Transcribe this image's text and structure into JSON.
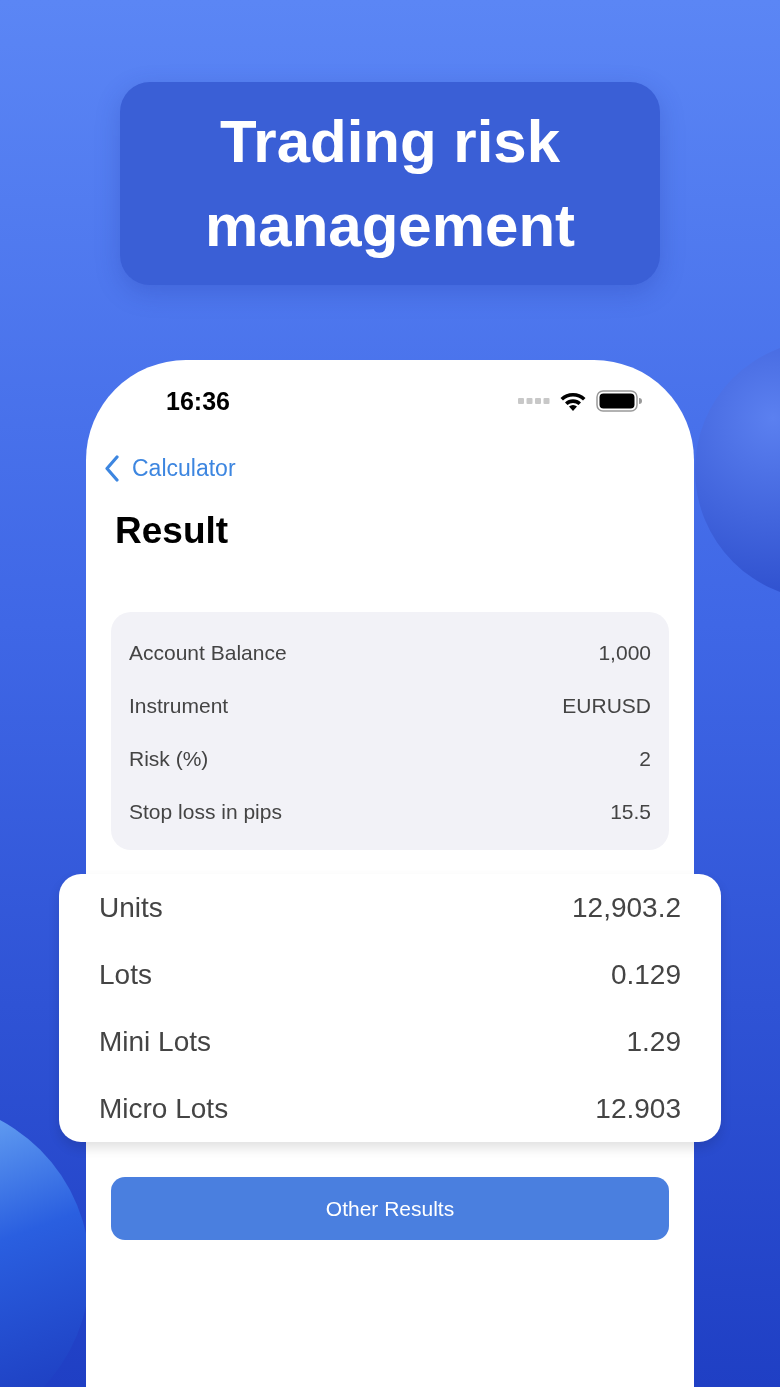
{
  "headline": "Trading risk management",
  "status_bar": {
    "time": "16:36"
  },
  "nav": {
    "back_label": "Calculator",
    "title": "Result"
  },
  "inputs": [
    {
      "label": "Account Balance",
      "value": "1,000"
    },
    {
      "label": "Instrument",
      "value": "EURUSD"
    },
    {
      "label": "Risk (%)",
      "value": "2"
    },
    {
      "label": "Stop loss in pips",
      "value": "15.5"
    }
  ],
  "results": [
    {
      "label": "Units",
      "value": "12,903.2"
    },
    {
      "label": "Lots",
      "value": "0.129"
    },
    {
      "label": "Mini Lots",
      "value": "1.29"
    },
    {
      "label": "Micro Lots",
      "value": "12.903"
    }
  ],
  "button": "Other Results"
}
